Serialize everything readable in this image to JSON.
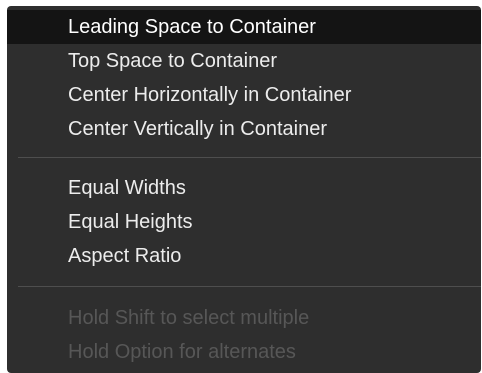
{
  "menu": {
    "group1": [
      "Leading Space to Container",
      "Top Space to Container",
      "Center Horizontally in Container",
      "Center Vertically in Container"
    ],
    "group2": [
      "Equal Widths",
      "Equal Heights",
      "Aspect Ratio"
    ],
    "hints": [
      "Hold Shift to select multiple",
      "Hold Option for alternates"
    ]
  },
  "colors": {
    "menu_background": "#2e2e2e",
    "highlight_background": "#141414",
    "text": "#ececec",
    "disabled_text": "#575757",
    "separator": "#4e4e4e"
  }
}
